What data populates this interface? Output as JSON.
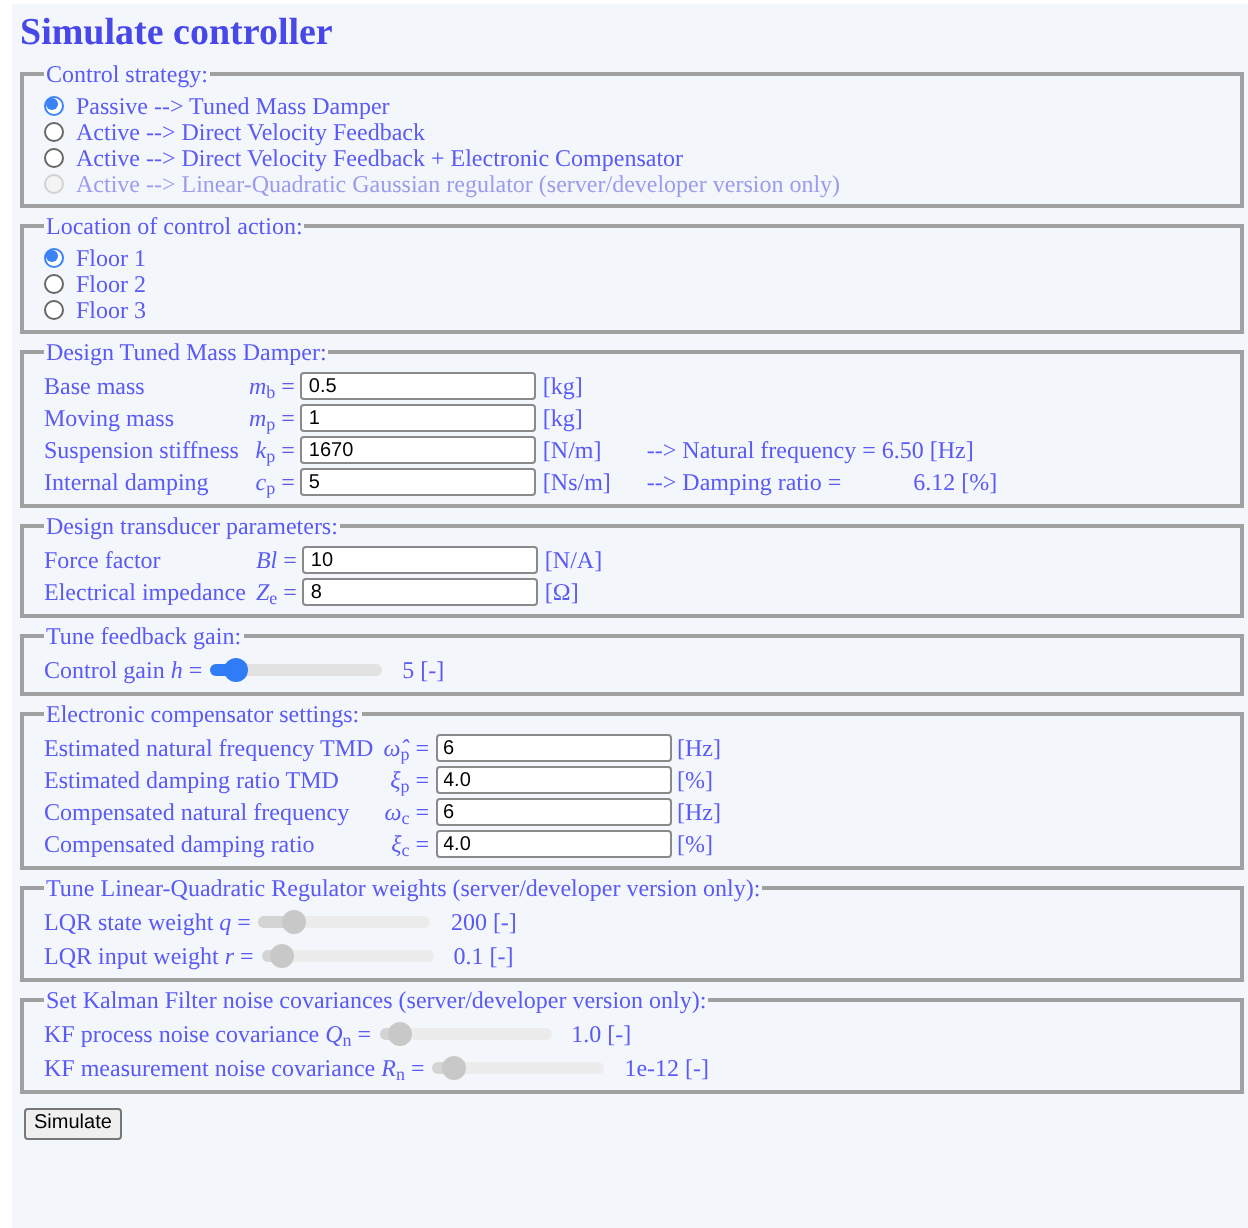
{
  "title": "Simulate controller",
  "sections": [
    {
      "kind": "radio",
      "legend": "Control strategy:",
      "options": [
        {
          "label": "Passive --> Tuned Mass Damper",
          "selected": true,
          "disabled": false
        },
        {
          "label": "Active --> Direct Velocity Feedback",
          "selected": false,
          "disabled": false
        },
        {
          "label": "Active --> Direct Velocity Feedback + Electronic Compensator",
          "selected": false,
          "disabled": false
        },
        {
          "label": "Active --> Linear-Quadratic Gaussian regulator (server/developer version only)",
          "selected": false,
          "disabled": true
        }
      ]
    },
    {
      "kind": "radio",
      "legend": "Location of control action:",
      "options": [
        {
          "label": "Floor 1",
          "selected": true,
          "disabled": false
        },
        {
          "label": "Floor 2",
          "selected": false,
          "disabled": false
        },
        {
          "label": "Floor 3",
          "selected": false,
          "disabled": false
        }
      ]
    },
    {
      "kind": "fields",
      "legend": "Design Tuned Mass Damper:",
      "rows": [
        {
          "label": "Base mass",
          "symbol": "*m*$_{b}$ =",
          "value": "0.5",
          "unit": "[kg]",
          "notes": []
        },
        {
          "label": "Moving mass",
          "symbol": "*m*$_{p}$ =",
          "value": "1",
          "unit": "[kg]",
          "notes": []
        },
        {
          "label": "Suspension stiffness",
          "symbol": "*k*$_{p}$ =",
          "value": "1670",
          "unit": "[N/m]",
          "notes": [
            "--> Natural frequency = 6.50 [Hz]"
          ]
        },
        {
          "label": "Internal damping",
          "symbol": "*c*$_{p}$ =",
          "value": "5",
          "unit": "[Ns/m]",
          "notes": [
            "--> Damping ratio =",
            "6.12 [%]"
          ]
        }
      ]
    },
    {
      "kind": "fields",
      "legend": "Design transducer parameters:",
      "rows": [
        {
          "label": "Force factor",
          "symbol": "*Bl* =",
          "value": "10",
          "unit": "[N/A]",
          "notes": []
        },
        {
          "label": "Electrical impedance",
          "symbol": "*Z*$_{e}$ =",
          "value": "8",
          "unit": "[Ω]",
          "notes": []
        }
      ]
    },
    {
      "kind": "sliders",
      "legend": "Tune feedback gain:",
      "rows": [
        {
          "label": "Control gain *h* =",
          "level": 0.15,
          "disabled": false,
          "reading": "5 [-]"
        }
      ]
    },
    {
      "kind": "fields",
      "legend": "Electronic compensator settings:",
      "rows": [
        {
          "label": "Estimated natural frequency TMD",
          "symbol": "*ω̂*$_{p}$ =",
          "value": "6",
          "unit": "[Hz]",
          "notes": []
        },
        {
          "label": "Estimated damping ratio TMD",
          "symbol": "*ξ*$_{p}$ =",
          "value": "4.0",
          "unit": "[%]",
          "notes": []
        },
        {
          "label": "Compensated natural frequency",
          "symbol": "*ω*$_{c}$ =",
          "value": "6",
          "unit": "[Hz]",
          "notes": []
        },
        {
          "label": "Compensated damping ratio",
          "symbol": "*ξ*$_{c}$ =",
          "value": "4.0",
          "unit": "[%]",
          "notes": []
        }
      ]
    },
    {
      "kind": "sliders",
      "legend": "Tune Linear-Quadratic Regulator weights (server/developer version only):",
      "rows": [
        {
          "label": "LQR state weight *q* =",
          "level": 0.2,
          "disabled": true,
          "reading": "200 [-]"
        },
        {
          "label": "LQR input weight *r* =",
          "level": 0.12,
          "disabled": true,
          "reading": "0.1 [-]"
        }
      ]
    },
    {
      "kind": "sliders",
      "legend": "Set Kalman Filter noise covariances (server/developer version only):",
      "rows": [
        {
          "label": "KF process noise covariance *Q*$_{n}$ =",
          "level": 0.12,
          "disabled": true,
          "reading": "1.0 [-]"
        },
        {
          "label": "KF measurement noise covariance *R*$_{n}$ =",
          "level": 0.12,
          "disabled": true,
          "reading": "1e-12 [-]"
        }
      ]
    }
  ],
  "button": "Simulate"
}
